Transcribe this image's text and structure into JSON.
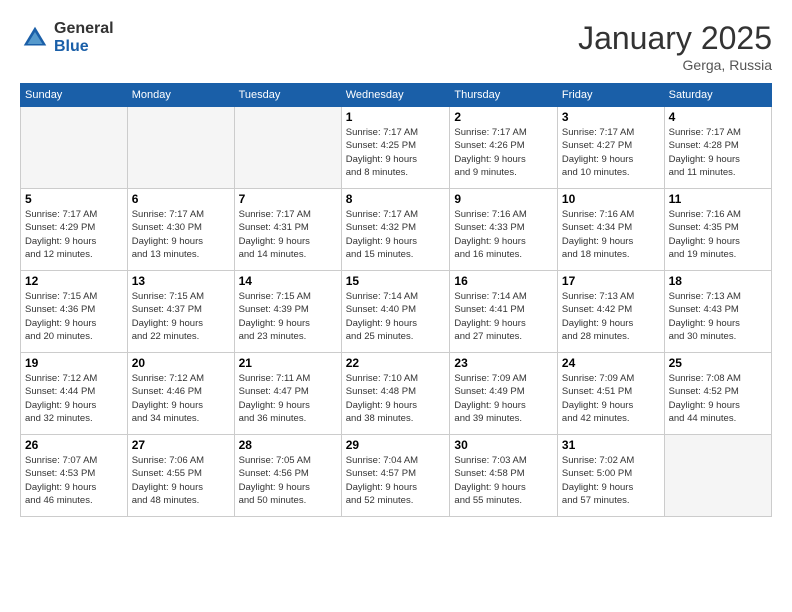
{
  "header": {
    "logo_general": "General",
    "logo_blue": "Blue",
    "title": "January 2025",
    "location": "Gerga, Russia"
  },
  "days_of_week": [
    "Sunday",
    "Monday",
    "Tuesday",
    "Wednesday",
    "Thursday",
    "Friday",
    "Saturday"
  ],
  "weeks": [
    [
      {
        "day": "",
        "info": ""
      },
      {
        "day": "",
        "info": ""
      },
      {
        "day": "",
        "info": ""
      },
      {
        "day": "1",
        "info": "Sunrise: 7:17 AM\nSunset: 4:25 PM\nDaylight: 9 hours\nand 8 minutes."
      },
      {
        "day": "2",
        "info": "Sunrise: 7:17 AM\nSunset: 4:26 PM\nDaylight: 9 hours\nand 9 minutes."
      },
      {
        "day": "3",
        "info": "Sunrise: 7:17 AM\nSunset: 4:27 PM\nDaylight: 9 hours\nand 10 minutes."
      },
      {
        "day": "4",
        "info": "Sunrise: 7:17 AM\nSunset: 4:28 PM\nDaylight: 9 hours\nand 11 minutes."
      }
    ],
    [
      {
        "day": "5",
        "info": "Sunrise: 7:17 AM\nSunset: 4:29 PM\nDaylight: 9 hours\nand 12 minutes."
      },
      {
        "day": "6",
        "info": "Sunrise: 7:17 AM\nSunset: 4:30 PM\nDaylight: 9 hours\nand 13 minutes."
      },
      {
        "day": "7",
        "info": "Sunrise: 7:17 AM\nSunset: 4:31 PM\nDaylight: 9 hours\nand 14 minutes."
      },
      {
        "day": "8",
        "info": "Sunrise: 7:17 AM\nSunset: 4:32 PM\nDaylight: 9 hours\nand 15 minutes."
      },
      {
        "day": "9",
        "info": "Sunrise: 7:16 AM\nSunset: 4:33 PM\nDaylight: 9 hours\nand 16 minutes."
      },
      {
        "day": "10",
        "info": "Sunrise: 7:16 AM\nSunset: 4:34 PM\nDaylight: 9 hours\nand 18 minutes."
      },
      {
        "day": "11",
        "info": "Sunrise: 7:16 AM\nSunset: 4:35 PM\nDaylight: 9 hours\nand 19 minutes."
      }
    ],
    [
      {
        "day": "12",
        "info": "Sunrise: 7:15 AM\nSunset: 4:36 PM\nDaylight: 9 hours\nand 20 minutes."
      },
      {
        "day": "13",
        "info": "Sunrise: 7:15 AM\nSunset: 4:37 PM\nDaylight: 9 hours\nand 22 minutes."
      },
      {
        "day": "14",
        "info": "Sunrise: 7:15 AM\nSunset: 4:39 PM\nDaylight: 9 hours\nand 23 minutes."
      },
      {
        "day": "15",
        "info": "Sunrise: 7:14 AM\nSunset: 4:40 PM\nDaylight: 9 hours\nand 25 minutes."
      },
      {
        "day": "16",
        "info": "Sunrise: 7:14 AM\nSunset: 4:41 PM\nDaylight: 9 hours\nand 27 minutes."
      },
      {
        "day": "17",
        "info": "Sunrise: 7:13 AM\nSunset: 4:42 PM\nDaylight: 9 hours\nand 28 minutes."
      },
      {
        "day": "18",
        "info": "Sunrise: 7:13 AM\nSunset: 4:43 PM\nDaylight: 9 hours\nand 30 minutes."
      }
    ],
    [
      {
        "day": "19",
        "info": "Sunrise: 7:12 AM\nSunset: 4:44 PM\nDaylight: 9 hours\nand 32 minutes."
      },
      {
        "day": "20",
        "info": "Sunrise: 7:12 AM\nSunset: 4:46 PM\nDaylight: 9 hours\nand 34 minutes."
      },
      {
        "day": "21",
        "info": "Sunrise: 7:11 AM\nSunset: 4:47 PM\nDaylight: 9 hours\nand 36 minutes."
      },
      {
        "day": "22",
        "info": "Sunrise: 7:10 AM\nSunset: 4:48 PM\nDaylight: 9 hours\nand 38 minutes."
      },
      {
        "day": "23",
        "info": "Sunrise: 7:09 AM\nSunset: 4:49 PM\nDaylight: 9 hours\nand 39 minutes."
      },
      {
        "day": "24",
        "info": "Sunrise: 7:09 AM\nSunset: 4:51 PM\nDaylight: 9 hours\nand 42 minutes."
      },
      {
        "day": "25",
        "info": "Sunrise: 7:08 AM\nSunset: 4:52 PM\nDaylight: 9 hours\nand 44 minutes."
      }
    ],
    [
      {
        "day": "26",
        "info": "Sunrise: 7:07 AM\nSunset: 4:53 PM\nDaylight: 9 hours\nand 46 minutes."
      },
      {
        "day": "27",
        "info": "Sunrise: 7:06 AM\nSunset: 4:55 PM\nDaylight: 9 hours\nand 48 minutes."
      },
      {
        "day": "28",
        "info": "Sunrise: 7:05 AM\nSunset: 4:56 PM\nDaylight: 9 hours\nand 50 minutes."
      },
      {
        "day": "29",
        "info": "Sunrise: 7:04 AM\nSunset: 4:57 PM\nDaylight: 9 hours\nand 52 minutes."
      },
      {
        "day": "30",
        "info": "Sunrise: 7:03 AM\nSunset: 4:58 PM\nDaylight: 9 hours\nand 55 minutes."
      },
      {
        "day": "31",
        "info": "Sunrise: 7:02 AM\nSunset: 5:00 PM\nDaylight: 9 hours\nand 57 minutes."
      },
      {
        "day": "",
        "info": ""
      }
    ]
  ]
}
